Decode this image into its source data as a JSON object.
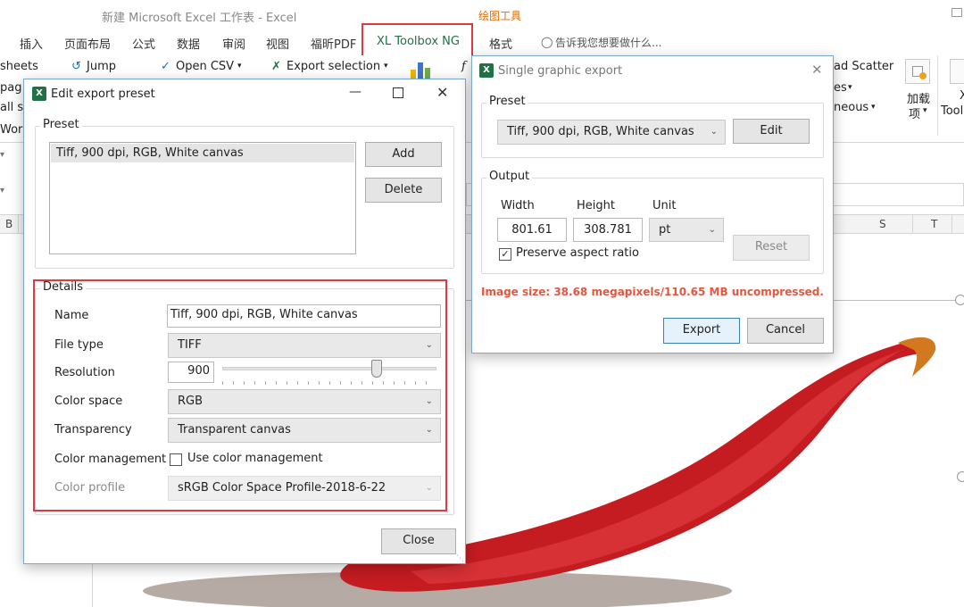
{
  "window": {
    "title": "新建 Microsoft Excel 工作表 - Excel",
    "context_label": "绘图工具"
  },
  "ribbon_tabs": [
    "插入",
    "页面布局",
    "公式",
    "数据",
    "审阅",
    "视图",
    "福昕PDF",
    "XL Toolbox NG",
    "格式"
  ],
  "tell_me": "告诉我您想要做什么...",
  "ribbon": {
    "sheets": "sheets",
    "jump": "Jump",
    "open_csv": "Open CSV",
    "export_selection": "Export selection",
    "pag": "pag",
    "all_s": "all s",
    "wor": "Wor",
    "ad_scatter": "ad Scatter",
    "es": "es",
    "neous": "neous",
    "addins_1": "加载",
    "addins_2": "项",
    "tool": "Tool",
    "x": "X"
  },
  "columns": [
    "B",
    "S",
    "T"
  ],
  "edit_dialog": {
    "title": "Edit export preset",
    "preset_group": "Preset",
    "preset_items": [
      "Tiff, 900 dpi, RGB, White canvas"
    ],
    "add": "Add",
    "delete": "Delete",
    "details_group": "Details",
    "name_label": "Name",
    "name_value": "Tiff, 900 dpi, RGB, White canvas",
    "filetype_label": "File type",
    "filetype_value": "TIFF",
    "resolution_label": "Resolution",
    "resolution_value": "900",
    "resolution_slider_fraction": 0.72,
    "colorspace_label": "Color space",
    "colorspace_value": "RGB",
    "transparency_label": "Transparency",
    "transparency_value": "Transparent canvas",
    "colormgmt_label": "Color management",
    "colormgmt_check_label": "Use color management",
    "colormgmt_checked": false,
    "profile_label": "Color profile",
    "profile_value": "sRGB Color Space Profile-2018-6-22",
    "close": "Close"
  },
  "single_dialog": {
    "title": "Single graphic export",
    "preset_group": "Preset",
    "preset_value": "Tiff, 900 dpi, RGB, White canvas",
    "edit": "Edit",
    "output_group": "Output",
    "width_label": "Width",
    "height_label": "Height",
    "unit_label": "Unit",
    "width_value": "801.61",
    "height_value": "308.781",
    "unit_value": "pt",
    "preserve_label": "Preserve aspect ratio",
    "preserve_checked": true,
    "reset": "Reset",
    "image_size": "Image size: 38.68 megapixels/110.65 MB uncompressed.",
    "export": "Export",
    "cancel": "Cancel"
  },
  "colors": {
    "highlight_red": "#e0393e",
    "toolbox_green": "#1f7244",
    "context_orange": "#e46c0a",
    "warning_red": "#e8553f",
    "pepper_red": "#c91d22"
  }
}
